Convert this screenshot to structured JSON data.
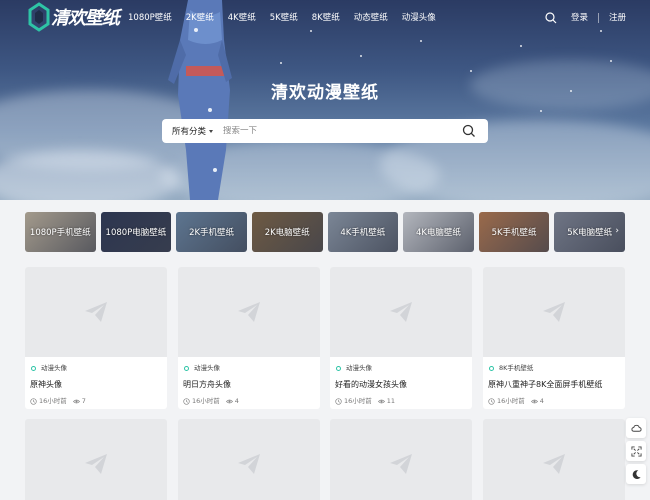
{
  "site": {
    "logo_text": "清欢壁纸",
    "hero_title": "清欢动漫壁纸"
  },
  "nav": {
    "menu": [
      "1080P壁纸",
      "2K壁纸",
      "4K壁纸",
      "5K壁纸",
      "8K壁纸",
      "动态壁纸",
      "动漫头像"
    ],
    "login": "登录",
    "register": "注册"
  },
  "search": {
    "category": "所有分类",
    "placeholder": "搜索一下"
  },
  "categories": [
    {
      "label": "1080P手机壁纸",
      "color": "#a39a8c"
    },
    {
      "label": "1080P电脑壁纸",
      "color": "#2d3650"
    },
    {
      "label": "2K手机壁纸",
      "color": "#5d7590"
    },
    {
      "label": "2K电脑壁纸",
      "color": "#6e5a43"
    },
    {
      "label": "4K手机壁纸",
      "color": "#7b8696"
    },
    {
      "label": "4K电脑壁纸",
      "color": "#b3b6bd"
    },
    {
      "label": "5K手机壁纸",
      "color": "#9a6a4b"
    },
    {
      "label": "5K电脑壁纸",
      "color": "#6f7585"
    }
  ],
  "cards": [
    {
      "tag": "动漫头像",
      "title": "原神头像",
      "time": "16小时前",
      "views": "7"
    },
    {
      "tag": "动漫头像",
      "title": "明日方舟头像",
      "time": "16小时前",
      "views": "4"
    },
    {
      "tag": "动漫头像",
      "title": "好看的动漫女孩头像",
      "time": "16小时前",
      "views": "11"
    },
    {
      "tag": "8K手机壁纸",
      "title": "原神八重神子8K全面屏手机壁纸",
      "time": "16小时前",
      "views": "4"
    }
  ],
  "colors": {
    "accent": "#2ec4a6",
    "placeholder_bg": "#e8e9eb",
    "page_bg": "#f2f3f5"
  },
  "icons": {
    "thumb": "paper-plane-icon",
    "time": "clock-icon",
    "views": "eye-icon",
    "tools": [
      "cloud-icon",
      "fullscreen-icon",
      "moon-icon"
    ]
  }
}
